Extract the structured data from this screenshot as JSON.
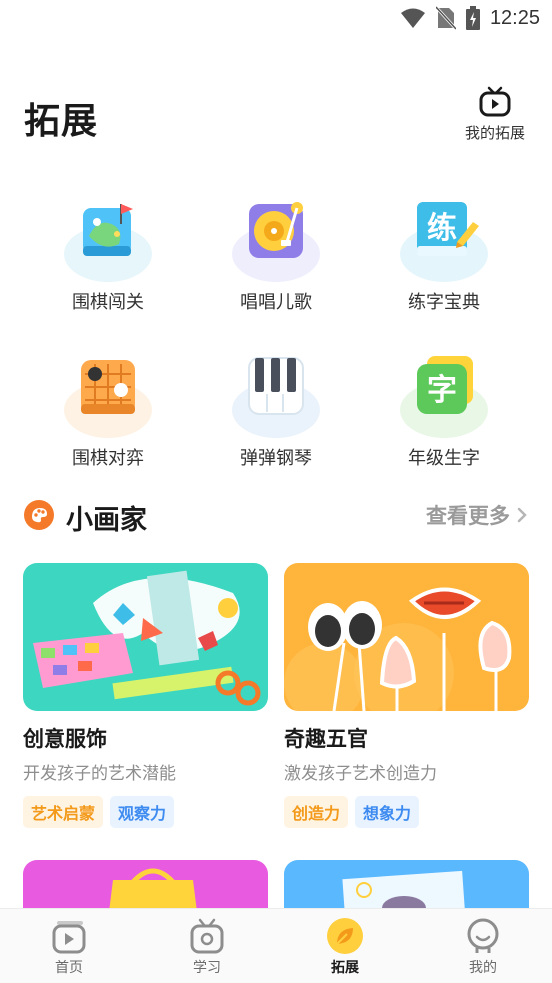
{
  "status_bar": {
    "time": "12:25"
  },
  "header": {
    "title": "拓展",
    "my_extension_label": "我的拓展"
  },
  "features": [
    {
      "label": "围棋闯关",
      "icon": "go-map-icon"
    },
    {
      "label": "唱唱儿歌",
      "icon": "record-player-icon"
    },
    {
      "label": "练字宝典",
      "icon": "writing-book-icon"
    },
    {
      "label": "围棋对弈",
      "icon": "go-board-icon"
    },
    {
      "label": "弹弹钢琴",
      "icon": "piano-icon"
    },
    {
      "label": "年级生字",
      "icon": "character-card-icon"
    }
  ],
  "section": {
    "title": "小画家",
    "more_label": "查看更多"
  },
  "cards": [
    {
      "title": "创意服饰",
      "desc": "开发孩子的艺术潜能",
      "tags": [
        "艺术启蒙",
        "观察力"
      ]
    },
    {
      "title": "奇趣五官",
      "desc": "激发孩子艺术创造力",
      "tags": [
        "创造力",
        "想象力"
      ]
    }
  ],
  "nav": [
    {
      "label": "首页",
      "active": false
    },
    {
      "label": "学习",
      "active": false
    },
    {
      "label": "拓展",
      "active": true
    },
    {
      "label": "我的",
      "active": false
    }
  ],
  "colors": {
    "accent_orange": "#f39a1b",
    "accent_blue": "#3d8bf0",
    "card1_bg": "#3dd6c0",
    "card2_bg": "#ffb43c",
    "card3_bg": "#e85be0",
    "card4_bg": "#5ab8ff"
  }
}
